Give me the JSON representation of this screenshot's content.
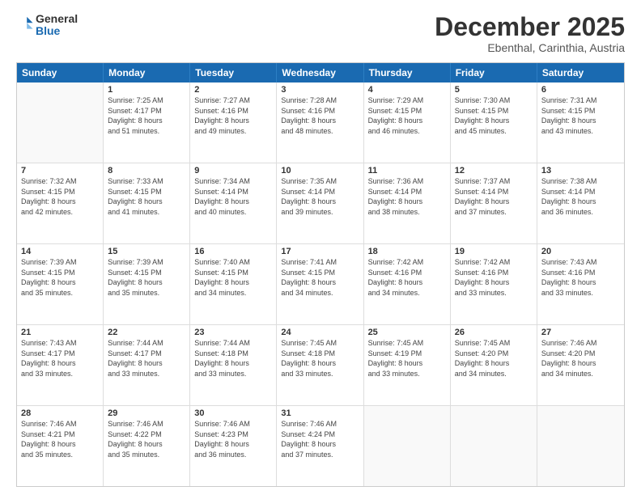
{
  "logo": {
    "line1": "General",
    "line2": "Blue"
  },
  "title": "December 2025",
  "subtitle": "Ebenthal, Carinthia, Austria",
  "headers": [
    "Sunday",
    "Monday",
    "Tuesday",
    "Wednesday",
    "Thursday",
    "Friday",
    "Saturday"
  ],
  "weeks": [
    [
      {
        "day": "",
        "info": ""
      },
      {
        "day": "1",
        "info": "Sunrise: 7:25 AM\nSunset: 4:17 PM\nDaylight: 8 hours\nand 51 minutes."
      },
      {
        "day": "2",
        "info": "Sunrise: 7:27 AM\nSunset: 4:16 PM\nDaylight: 8 hours\nand 49 minutes."
      },
      {
        "day": "3",
        "info": "Sunrise: 7:28 AM\nSunset: 4:16 PM\nDaylight: 8 hours\nand 48 minutes."
      },
      {
        "day": "4",
        "info": "Sunrise: 7:29 AM\nSunset: 4:15 PM\nDaylight: 8 hours\nand 46 minutes."
      },
      {
        "day": "5",
        "info": "Sunrise: 7:30 AM\nSunset: 4:15 PM\nDaylight: 8 hours\nand 45 minutes."
      },
      {
        "day": "6",
        "info": "Sunrise: 7:31 AM\nSunset: 4:15 PM\nDaylight: 8 hours\nand 43 minutes."
      }
    ],
    [
      {
        "day": "7",
        "info": "Sunrise: 7:32 AM\nSunset: 4:15 PM\nDaylight: 8 hours\nand 42 minutes."
      },
      {
        "day": "8",
        "info": "Sunrise: 7:33 AM\nSunset: 4:15 PM\nDaylight: 8 hours\nand 41 minutes."
      },
      {
        "day": "9",
        "info": "Sunrise: 7:34 AM\nSunset: 4:14 PM\nDaylight: 8 hours\nand 40 minutes."
      },
      {
        "day": "10",
        "info": "Sunrise: 7:35 AM\nSunset: 4:14 PM\nDaylight: 8 hours\nand 39 minutes."
      },
      {
        "day": "11",
        "info": "Sunrise: 7:36 AM\nSunset: 4:14 PM\nDaylight: 8 hours\nand 38 minutes."
      },
      {
        "day": "12",
        "info": "Sunrise: 7:37 AM\nSunset: 4:14 PM\nDaylight: 8 hours\nand 37 minutes."
      },
      {
        "day": "13",
        "info": "Sunrise: 7:38 AM\nSunset: 4:14 PM\nDaylight: 8 hours\nand 36 minutes."
      }
    ],
    [
      {
        "day": "14",
        "info": "Sunrise: 7:39 AM\nSunset: 4:15 PM\nDaylight: 8 hours\nand 35 minutes."
      },
      {
        "day": "15",
        "info": "Sunrise: 7:39 AM\nSunset: 4:15 PM\nDaylight: 8 hours\nand 35 minutes."
      },
      {
        "day": "16",
        "info": "Sunrise: 7:40 AM\nSunset: 4:15 PM\nDaylight: 8 hours\nand 34 minutes."
      },
      {
        "day": "17",
        "info": "Sunrise: 7:41 AM\nSunset: 4:15 PM\nDaylight: 8 hours\nand 34 minutes."
      },
      {
        "day": "18",
        "info": "Sunrise: 7:42 AM\nSunset: 4:16 PM\nDaylight: 8 hours\nand 34 minutes."
      },
      {
        "day": "19",
        "info": "Sunrise: 7:42 AM\nSunset: 4:16 PM\nDaylight: 8 hours\nand 33 minutes."
      },
      {
        "day": "20",
        "info": "Sunrise: 7:43 AM\nSunset: 4:16 PM\nDaylight: 8 hours\nand 33 minutes."
      }
    ],
    [
      {
        "day": "21",
        "info": "Sunrise: 7:43 AM\nSunset: 4:17 PM\nDaylight: 8 hours\nand 33 minutes."
      },
      {
        "day": "22",
        "info": "Sunrise: 7:44 AM\nSunset: 4:17 PM\nDaylight: 8 hours\nand 33 minutes."
      },
      {
        "day": "23",
        "info": "Sunrise: 7:44 AM\nSunset: 4:18 PM\nDaylight: 8 hours\nand 33 minutes."
      },
      {
        "day": "24",
        "info": "Sunrise: 7:45 AM\nSunset: 4:18 PM\nDaylight: 8 hours\nand 33 minutes."
      },
      {
        "day": "25",
        "info": "Sunrise: 7:45 AM\nSunset: 4:19 PM\nDaylight: 8 hours\nand 33 minutes."
      },
      {
        "day": "26",
        "info": "Sunrise: 7:45 AM\nSunset: 4:20 PM\nDaylight: 8 hours\nand 34 minutes."
      },
      {
        "day": "27",
        "info": "Sunrise: 7:46 AM\nSunset: 4:20 PM\nDaylight: 8 hours\nand 34 minutes."
      }
    ],
    [
      {
        "day": "28",
        "info": "Sunrise: 7:46 AM\nSunset: 4:21 PM\nDaylight: 8 hours\nand 35 minutes."
      },
      {
        "day": "29",
        "info": "Sunrise: 7:46 AM\nSunset: 4:22 PM\nDaylight: 8 hours\nand 35 minutes."
      },
      {
        "day": "30",
        "info": "Sunrise: 7:46 AM\nSunset: 4:23 PM\nDaylight: 8 hours\nand 36 minutes."
      },
      {
        "day": "31",
        "info": "Sunrise: 7:46 AM\nSunset: 4:24 PM\nDaylight: 8 hours\nand 37 minutes."
      },
      {
        "day": "",
        "info": ""
      },
      {
        "day": "",
        "info": ""
      },
      {
        "day": "",
        "info": ""
      }
    ]
  ]
}
